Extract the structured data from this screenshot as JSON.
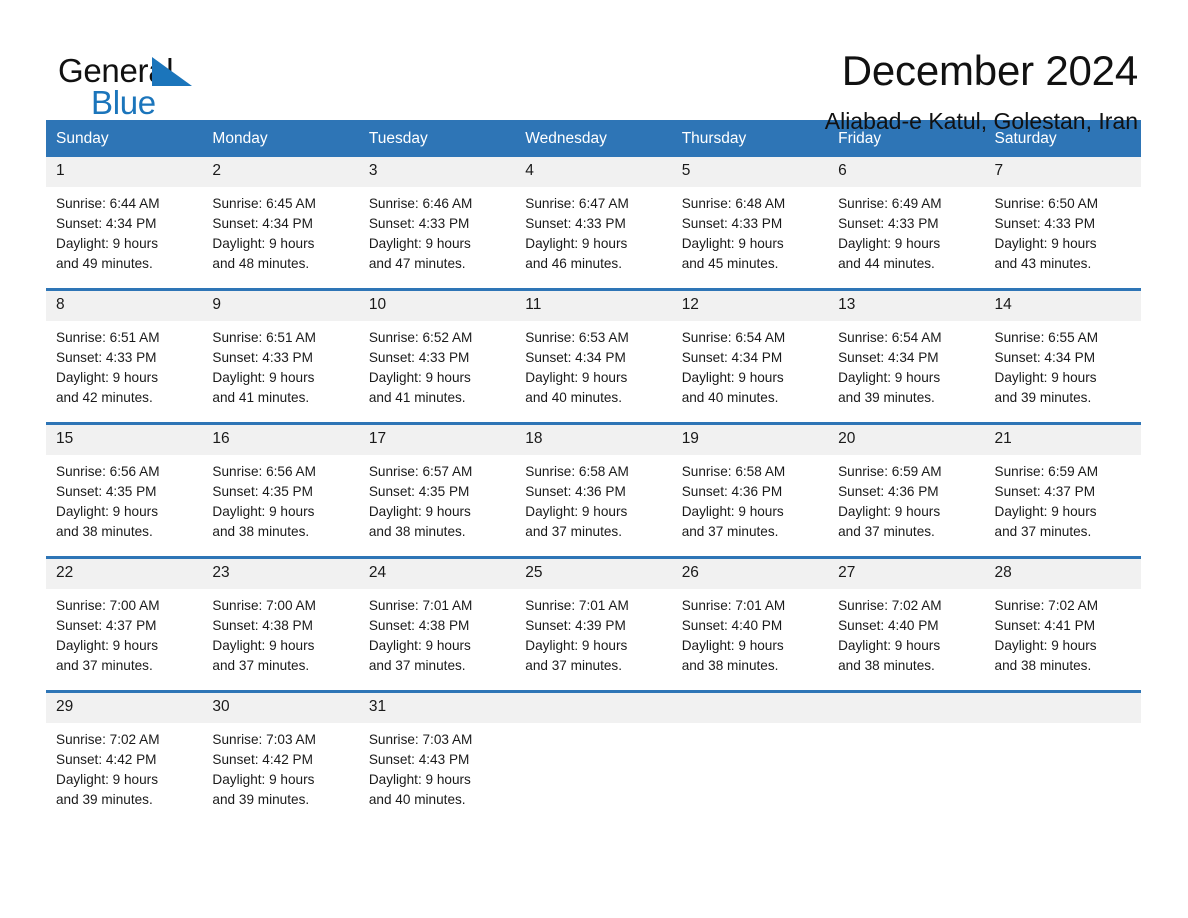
{
  "brand": {
    "name_part1": "General",
    "name_part2": "Blue",
    "accent_color": "#1b75bb"
  },
  "header": {
    "title": "December 2024",
    "location": "Aliabad-e Katul, Golestan, Iran",
    "header_color": "#2e75b6",
    "daynum_band_color": "#f1f1f1"
  },
  "weekdays": [
    "Sunday",
    "Monday",
    "Tuesday",
    "Wednesday",
    "Thursday",
    "Friday",
    "Saturday"
  ],
  "labels": {
    "sunrise_prefix": "Sunrise:",
    "sunset_prefix": "Sunset:",
    "daylight_prefix": "Daylight:"
  },
  "weeks": [
    [
      {
        "day": "1",
        "sunrise": "Sunrise: 6:44 AM",
        "sunset": "Sunset: 4:34 PM",
        "daylight_line1": "Daylight: 9 hours",
        "daylight_line2": "and 49 minutes."
      },
      {
        "day": "2",
        "sunrise": "Sunrise: 6:45 AM",
        "sunset": "Sunset: 4:34 PM",
        "daylight_line1": "Daylight: 9 hours",
        "daylight_line2": "and 48 minutes."
      },
      {
        "day": "3",
        "sunrise": "Sunrise: 6:46 AM",
        "sunset": "Sunset: 4:33 PM",
        "daylight_line1": "Daylight: 9 hours",
        "daylight_line2": "and 47 minutes."
      },
      {
        "day": "4",
        "sunrise": "Sunrise: 6:47 AM",
        "sunset": "Sunset: 4:33 PM",
        "daylight_line1": "Daylight: 9 hours",
        "daylight_line2": "and 46 minutes."
      },
      {
        "day": "5",
        "sunrise": "Sunrise: 6:48 AM",
        "sunset": "Sunset: 4:33 PM",
        "daylight_line1": "Daylight: 9 hours",
        "daylight_line2": "and 45 minutes."
      },
      {
        "day": "6",
        "sunrise": "Sunrise: 6:49 AM",
        "sunset": "Sunset: 4:33 PM",
        "daylight_line1": "Daylight: 9 hours",
        "daylight_line2": "and 44 minutes."
      },
      {
        "day": "7",
        "sunrise": "Sunrise: 6:50 AM",
        "sunset": "Sunset: 4:33 PM",
        "daylight_line1": "Daylight: 9 hours",
        "daylight_line2": "and 43 minutes."
      }
    ],
    [
      {
        "day": "8",
        "sunrise": "Sunrise: 6:51 AM",
        "sunset": "Sunset: 4:33 PM",
        "daylight_line1": "Daylight: 9 hours",
        "daylight_line2": "and 42 minutes."
      },
      {
        "day": "9",
        "sunrise": "Sunrise: 6:51 AM",
        "sunset": "Sunset: 4:33 PM",
        "daylight_line1": "Daylight: 9 hours",
        "daylight_line2": "and 41 minutes."
      },
      {
        "day": "10",
        "sunrise": "Sunrise: 6:52 AM",
        "sunset": "Sunset: 4:33 PM",
        "daylight_line1": "Daylight: 9 hours",
        "daylight_line2": "and 41 minutes."
      },
      {
        "day": "11",
        "sunrise": "Sunrise: 6:53 AM",
        "sunset": "Sunset: 4:34 PM",
        "daylight_line1": "Daylight: 9 hours",
        "daylight_line2": "and 40 minutes."
      },
      {
        "day": "12",
        "sunrise": "Sunrise: 6:54 AM",
        "sunset": "Sunset: 4:34 PM",
        "daylight_line1": "Daylight: 9 hours",
        "daylight_line2": "and 40 minutes."
      },
      {
        "day": "13",
        "sunrise": "Sunrise: 6:54 AM",
        "sunset": "Sunset: 4:34 PM",
        "daylight_line1": "Daylight: 9 hours",
        "daylight_line2": "and 39 minutes."
      },
      {
        "day": "14",
        "sunrise": "Sunrise: 6:55 AM",
        "sunset": "Sunset: 4:34 PM",
        "daylight_line1": "Daylight: 9 hours",
        "daylight_line2": "and 39 minutes."
      }
    ],
    [
      {
        "day": "15",
        "sunrise": "Sunrise: 6:56 AM",
        "sunset": "Sunset: 4:35 PM",
        "daylight_line1": "Daylight: 9 hours",
        "daylight_line2": "and 38 minutes."
      },
      {
        "day": "16",
        "sunrise": "Sunrise: 6:56 AM",
        "sunset": "Sunset: 4:35 PM",
        "daylight_line1": "Daylight: 9 hours",
        "daylight_line2": "and 38 minutes."
      },
      {
        "day": "17",
        "sunrise": "Sunrise: 6:57 AM",
        "sunset": "Sunset: 4:35 PM",
        "daylight_line1": "Daylight: 9 hours",
        "daylight_line2": "and 38 minutes."
      },
      {
        "day": "18",
        "sunrise": "Sunrise: 6:58 AM",
        "sunset": "Sunset: 4:36 PM",
        "daylight_line1": "Daylight: 9 hours",
        "daylight_line2": "and 37 minutes."
      },
      {
        "day": "19",
        "sunrise": "Sunrise: 6:58 AM",
        "sunset": "Sunset: 4:36 PM",
        "daylight_line1": "Daylight: 9 hours",
        "daylight_line2": "and 37 minutes."
      },
      {
        "day": "20",
        "sunrise": "Sunrise: 6:59 AM",
        "sunset": "Sunset: 4:36 PM",
        "daylight_line1": "Daylight: 9 hours",
        "daylight_line2": "and 37 minutes."
      },
      {
        "day": "21",
        "sunrise": "Sunrise: 6:59 AM",
        "sunset": "Sunset: 4:37 PM",
        "daylight_line1": "Daylight: 9 hours",
        "daylight_line2": "and 37 minutes."
      }
    ],
    [
      {
        "day": "22",
        "sunrise": "Sunrise: 7:00 AM",
        "sunset": "Sunset: 4:37 PM",
        "daylight_line1": "Daylight: 9 hours",
        "daylight_line2": "and 37 minutes."
      },
      {
        "day": "23",
        "sunrise": "Sunrise: 7:00 AM",
        "sunset": "Sunset: 4:38 PM",
        "daylight_line1": "Daylight: 9 hours",
        "daylight_line2": "and 37 minutes."
      },
      {
        "day": "24",
        "sunrise": "Sunrise: 7:01 AM",
        "sunset": "Sunset: 4:38 PM",
        "daylight_line1": "Daylight: 9 hours",
        "daylight_line2": "and 37 minutes."
      },
      {
        "day": "25",
        "sunrise": "Sunrise: 7:01 AM",
        "sunset": "Sunset: 4:39 PM",
        "daylight_line1": "Daylight: 9 hours",
        "daylight_line2": "and 37 minutes."
      },
      {
        "day": "26",
        "sunrise": "Sunrise: 7:01 AM",
        "sunset": "Sunset: 4:40 PM",
        "daylight_line1": "Daylight: 9 hours",
        "daylight_line2": "and 38 minutes."
      },
      {
        "day": "27",
        "sunrise": "Sunrise: 7:02 AM",
        "sunset": "Sunset: 4:40 PM",
        "daylight_line1": "Daylight: 9 hours",
        "daylight_line2": "and 38 minutes."
      },
      {
        "day": "28",
        "sunrise": "Sunrise: 7:02 AM",
        "sunset": "Sunset: 4:41 PM",
        "daylight_line1": "Daylight: 9 hours",
        "daylight_line2": "and 38 minutes."
      }
    ],
    [
      {
        "day": "29",
        "sunrise": "Sunrise: 7:02 AM",
        "sunset": "Sunset: 4:42 PM",
        "daylight_line1": "Daylight: 9 hours",
        "daylight_line2": "and 39 minutes."
      },
      {
        "day": "30",
        "sunrise": "Sunrise: 7:03 AM",
        "sunset": "Sunset: 4:42 PM",
        "daylight_line1": "Daylight: 9 hours",
        "daylight_line2": "and 39 minutes."
      },
      {
        "day": "31",
        "sunrise": "Sunrise: 7:03 AM",
        "sunset": "Sunset: 4:43 PM",
        "daylight_line1": "Daylight: 9 hours",
        "daylight_line2": "and 40 minutes."
      },
      {
        "day": "",
        "sunrise": "",
        "sunset": "",
        "daylight_line1": "",
        "daylight_line2": ""
      },
      {
        "day": "",
        "sunrise": "",
        "sunset": "",
        "daylight_line1": "",
        "daylight_line2": ""
      },
      {
        "day": "",
        "sunrise": "",
        "sunset": "",
        "daylight_line1": "",
        "daylight_line2": ""
      },
      {
        "day": "",
        "sunrise": "",
        "sunset": "",
        "daylight_line1": "",
        "daylight_line2": ""
      }
    ]
  ]
}
